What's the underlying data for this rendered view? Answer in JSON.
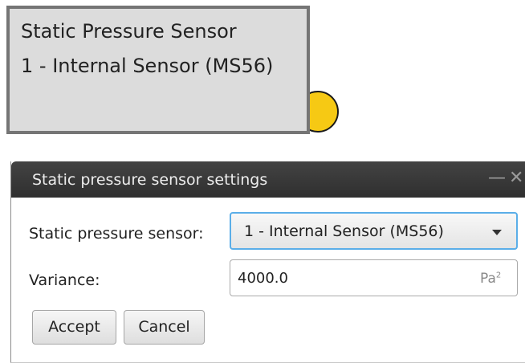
{
  "node": {
    "line1": "Static Pressure Sensor",
    "line2": "1 - Internal Sensor (MS56)"
  },
  "dialog": {
    "title": "Static pressure sensor settings",
    "minimize_glyph": "—",
    "close_glyph": "✕",
    "sensor_label": "Static pressure sensor:",
    "sensor_value": "1 - Internal Sensor (MS56)",
    "variance_label": "Variance:",
    "variance_value": "4000.0",
    "variance_unit": "Pa",
    "variance_unit_exp": "2",
    "accept_label": "Accept",
    "cancel_label": "Cancel"
  },
  "colors": {
    "port": "#f6c914",
    "titlebar": "#3a3a3a",
    "focus": "#5aaee8"
  }
}
